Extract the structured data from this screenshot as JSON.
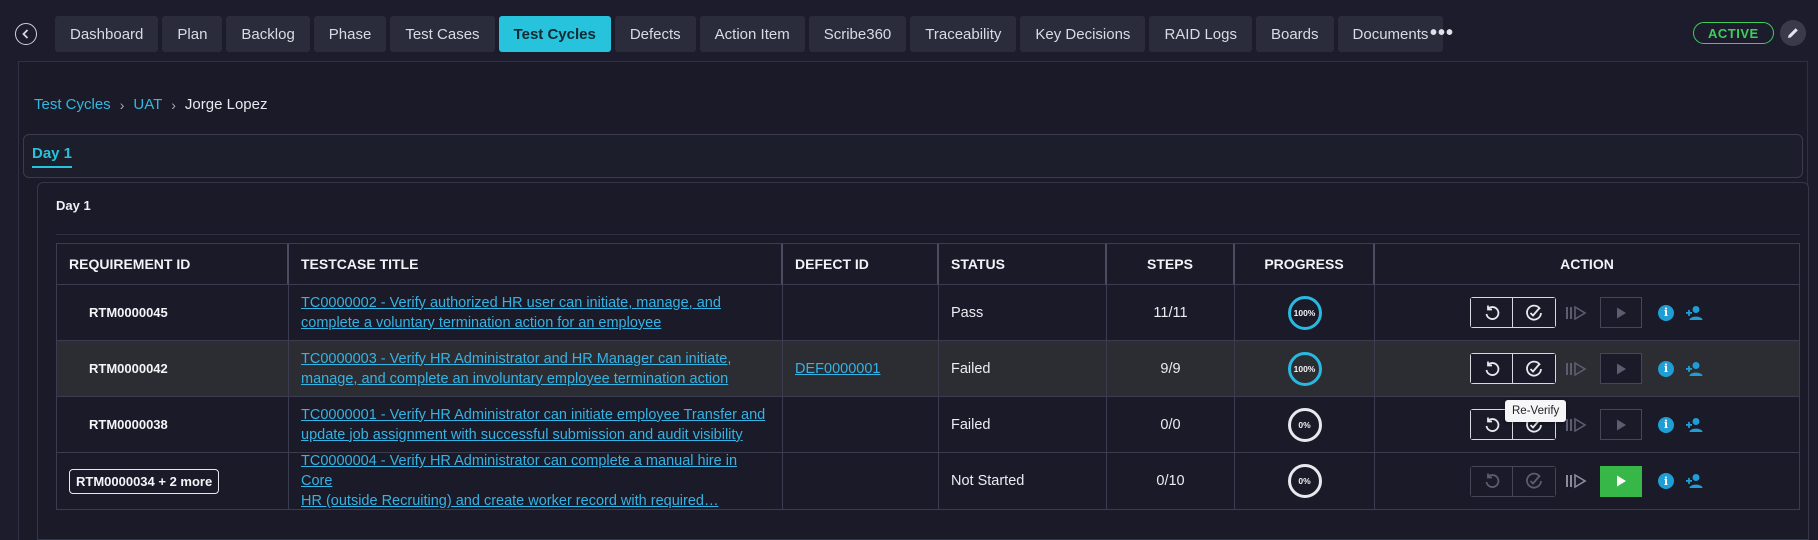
{
  "nav": {
    "tabs": [
      {
        "label": "Dashboard"
      },
      {
        "label": "Plan"
      },
      {
        "label": "Backlog"
      },
      {
        "label": "Phase"
      },
      {
        "label": "Test Cases"
      },
      {
        "label": "Test Cycles",
        "active": true
      },
      {
        "label": "Defects"
      },
      {
        "label": "Action Item"
      },
      {
        "label": "Scribe360"
      },
      {
        "label": "Traceability"
      },
      {
        "label": "Key Decisions"
      },
      {
        "label": "RAID Logs"
      },
      {
        "label": "Boards"
      },
      {
        "label": "Documents"
      }
    ],
    "more_label": "•••",
    "status_badge": "ACTIVE",
    "status_color": "#3ecf5b",
    "accent_color": "#27c2dc"
  },
  "breadcrumb": {
    "items": [
      {
        "label": "Test Cycles",
        "link": true
      },
      {
        "label": "UAT",
        "link": true
      },
      {
        "label": "Jorge Lopez",
        "link": false
      }
    ],
    "separator": "›"
  },
  "day_tabs": [
    {
      "label": "Day 1",
      "active": true
    }
  ],
  "section_title": "Day 1",
  "table": {
    "headers": [
      "REQUIREMENT ID",
      "TESTCASE TITLE",
      "DEFECT ID",
      "STATUS",
      "STEPS",
      "PROGRESS",
      "ACTION"
    ],
    "rows": [
      {
        "req": "RTM0000045",
        "req_boxed": false,
        "title_l1": "TC0000002 - Verify authorized HR user can initiate, manage, and",
        "title_l2": "complete a voluntary termination action for an employee",
        "defect": "",
        "status": "Pass",
        "steps": "11/11",
        "progress": "100%",
        "highlight": false
      },
      {
        "req": "RTM0000042",
        "req_boxed": false,
        "title_l1": "TC0000003 - Verify HR Administrator and HR Manager can initiate,",
        "title_l2": "manage, and complete an involuntary employee termination action",
        "defect": "DEF0000001",
        "status": "Failed",
        "steps": "9/9",
        "progress": "100%",
        "highlight": true
      },
      {
        "req": "RTM0000038",
        "req_boxed": false,
        "title_l1": "TC0000001 - Verify HR Administrator can initiate employee Transfer and",
        "title_l2": "update job assignment with successful submission and audit visibility",
        "defect": "",
        "status": "Failed",
        "steps": "0/0",
        "progress": "0%",
        "highlight": false
      },
      {
        "req": "RTM0000034 + 2 more",
        "req_boxed": true,
        "title_l1": "TC0000004 - Verify HR Administrator can complete a manual hire in Core",
        "title_l2": "HR (outside Recruiting) and create worker record with required…",
        "defect": "",
        "status": "Not Started",
        "steps": "0/10",
        "progress": "0%",
        "highlight": false
      }
    ]
  },
  "tooltip": "Re-Verify"
}
